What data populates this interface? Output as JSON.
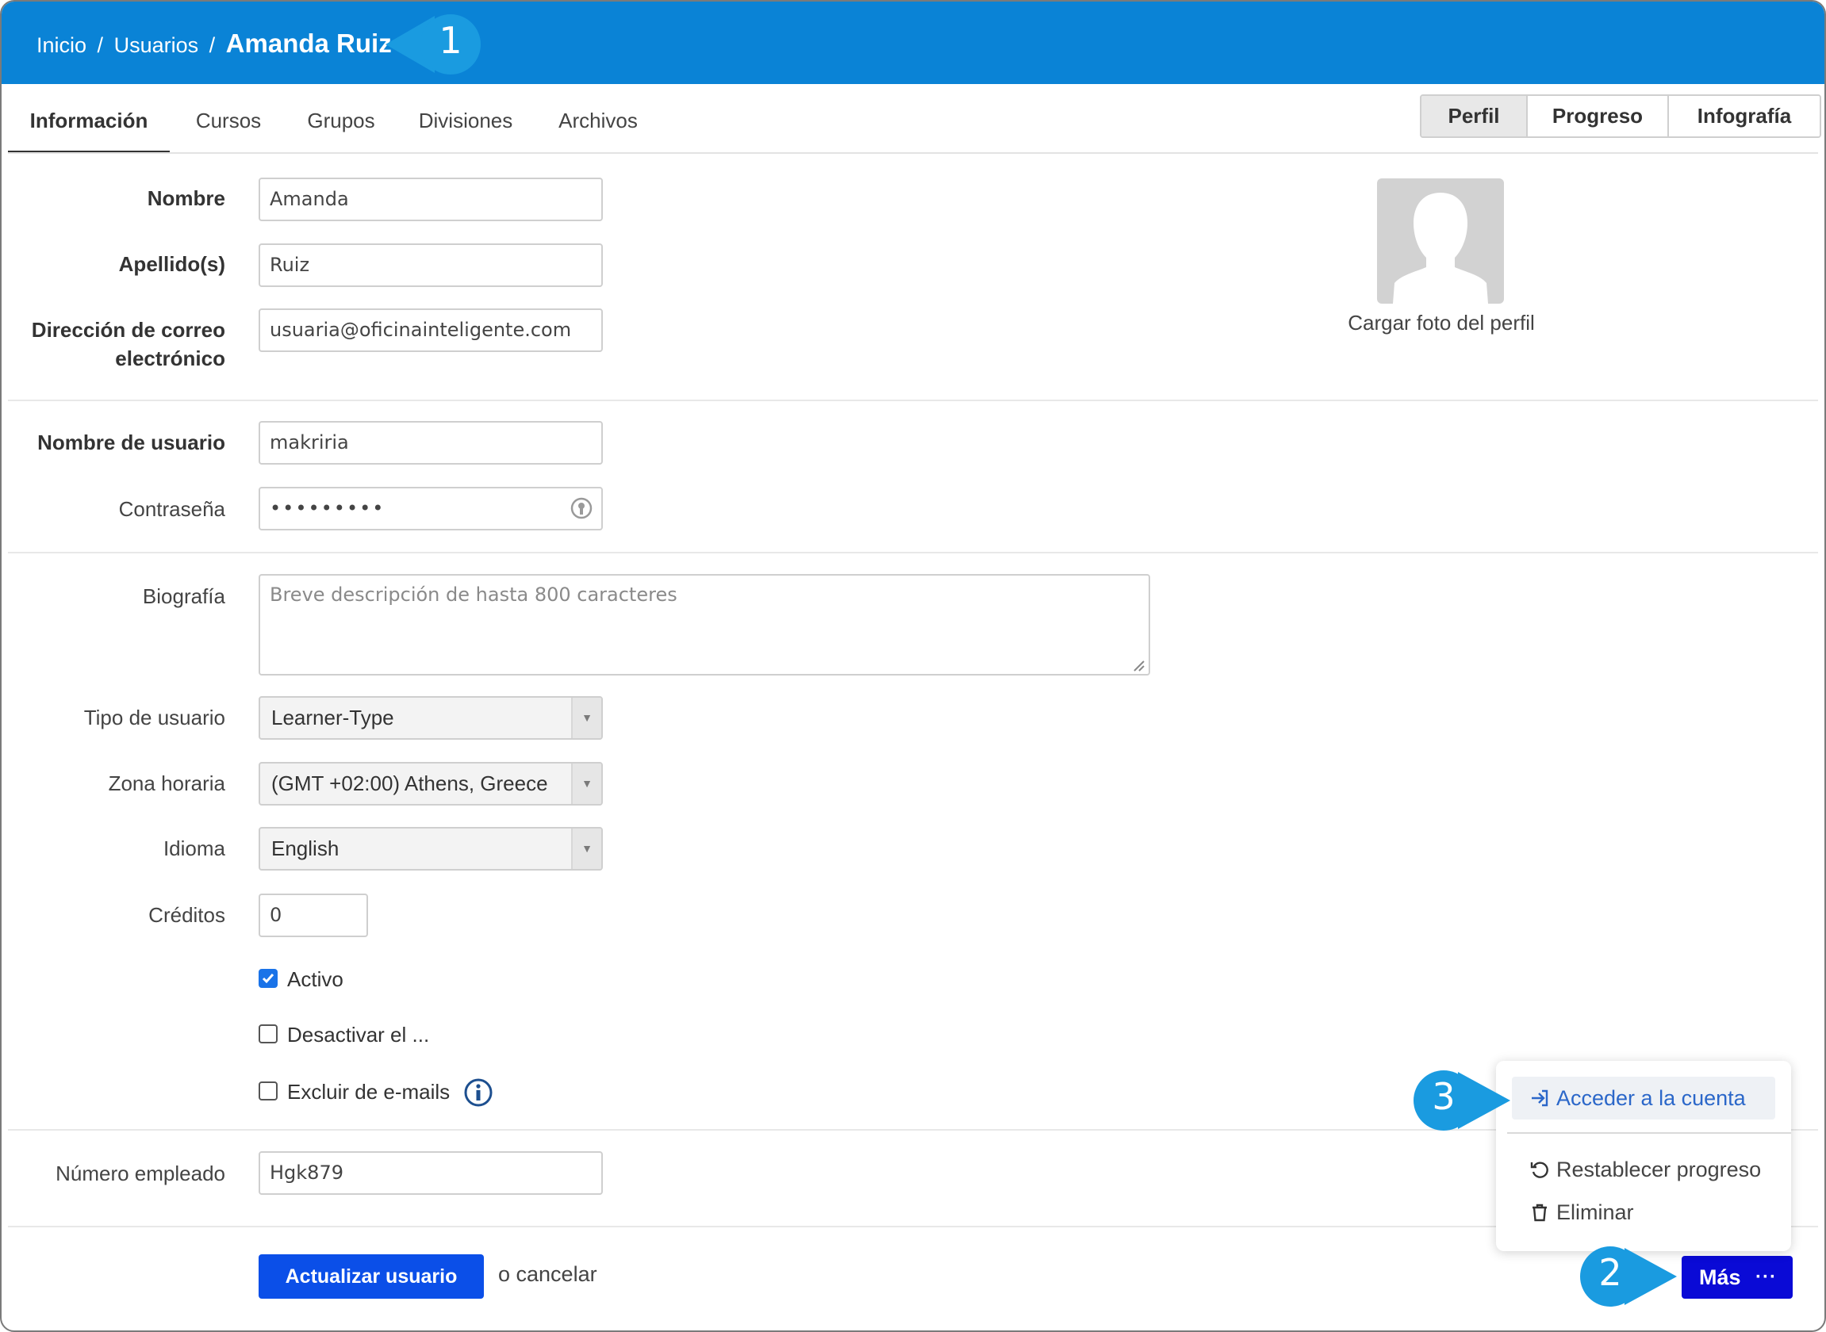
{
  "breadcrumb": {
    "home": "Inicio",
    "section": "Usuarios",
    "current": "Amanda Ruiz",
    "separator": "/"
  },
  "tabs": [
    {
      "label": "Información",
      "active": true
    },
    {
      "label": "Cursos"
    },
    {
      "label": "Grupos"
    },
    {
      "label": "Divisiones"
    },
    {
      "label": "Archivos"
    }
  ],
  "view_switch": [
    {
      "label": "Perfil",
      "active": true
    },
    {
      "label": "Progreso"
    },
    {
      "label": "Infografía"
    }
  ],
  "form": {
    "first_name": {
      "label": "Nombre",
      "value": "Amanda"
    },
    "last_name": {
      "label": "Apellido(s)",
      "value": "Ruiz"
    },
    "email": {
      "label_line1": "Dirección de correo",
      "label_line2": "electrónico",
      "value": "usuaria@oficinainteligente.com"
    },
    "username": {
      "label": "Nombre de usuario",
      "value": "makriria"
    },
    "password": {
      "label": "Contraseña",
      "value": "•••••••••"
    },
    "bio": {
      "label": "Biografía",
      "placeholder": "Breve descripción de hasta 800 caracteres"
    },
    "user_type": {
      "label": "Tipo de usuario",
      "value": "Learner-Type"
    },
    "timezone": {
      "label": "Zona horaria",
      "value": "(GMT +02:00) Athens, Greece"
    },
    "language": {
      "label": "Idioma",
      "value": "English"
    },
    "credits": {
      "label": "Créditos",
      "value": "0"
    },
    "active": {
      "label": "Activo",
      "checked": true
    },
    "deactivate": {
      "label": "Desactivar el ...",
      "checked": false
    },
    "exclude_emails": {
      "label": "Excluir de e-mails",
      "checked": false
    },
    "employee_number": {
      "label": "Número empleado",
      "value": "Hgk879"
    }
  },
  "avatar": {
    "caption": "Cargar foto del perfil"
  },
  "actions": {
    "update": "Actualizar usuario",
    "cancel": "o cancelar",
    "more": "Más",
    "more_dots": "···"
  },
  "menu": {
    "items": [
      {
        "label": "Acceder a la cuenta",
        "icon": "login-icon",
        "highlighted": true
      },
      {
        "label": "Restablecer progreso",
        "icon": "reset-icon"
      },
      {
        "label": "Eliminar",
        "icon": "trash-icon"
      }
    ]
  },
  "callouts": [
    "1",
    "2",
    "3"
  ],
  "colors": {
    "header": "#0a83d6",
    "primary_button": "#0b4fe8",
    "more_button": "#0a0ad6",
    "callout": "#1a9be0",
    "menu_highlight_text": "#2b67c9"
  }
}
